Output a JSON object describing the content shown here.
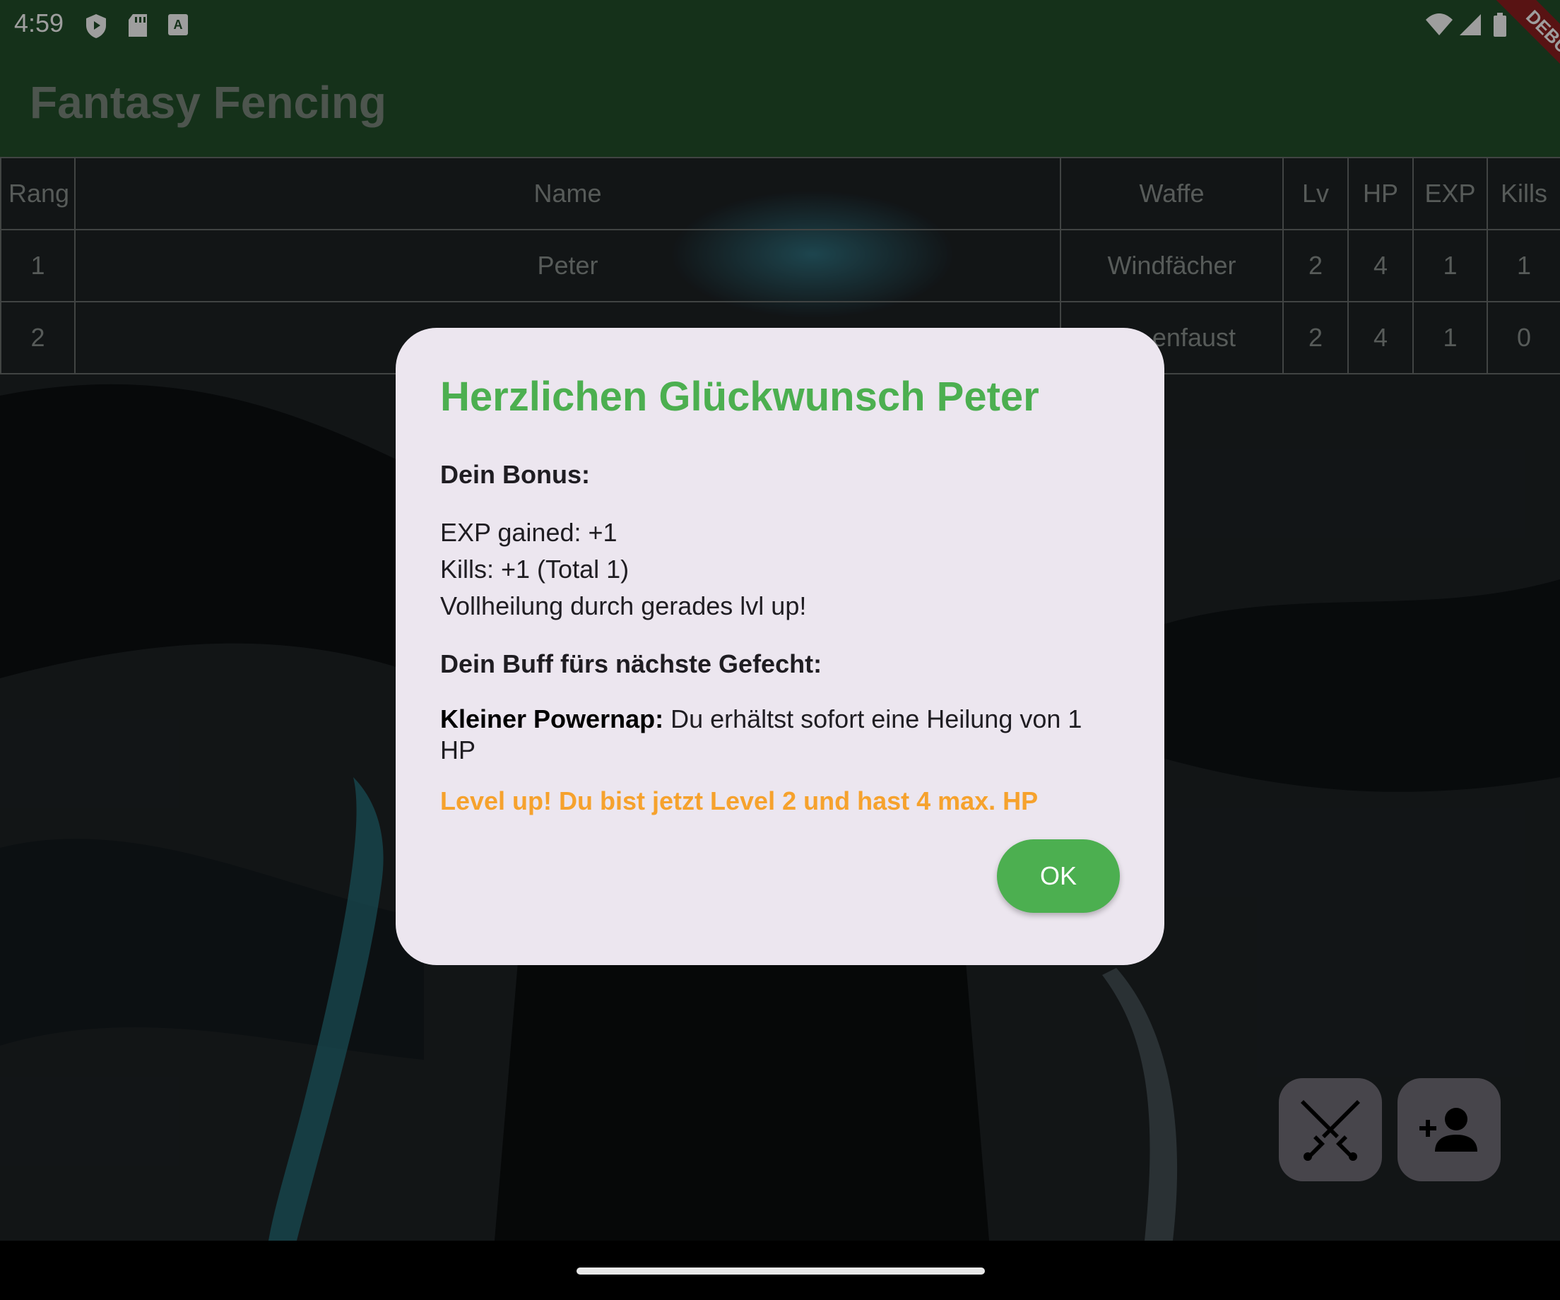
{
  "status_bar": {
    "time": "4:59",
    "icons": [
      "shield-icon",
      "sd-card-icon",
      "font-icon",
      "wifi-icon",
      "signal-icon",
      "battery-icon"
    ]
  },
  "app_bar": {
    "title": "Fantasy Fencing"
  },
  "debug_banner": {
    "label": "DEBUG"
  },
  "table": {
    "headers": [
      "Rang",
      "Name",
      "Waffe",
      "Lv",
      "HP",
      "EXP",
      "Kills"
    ],
    "rows": [
      {
        "rang": "1",
        "name": "Peter",
        "waffe": "Windfächer",
        "lv": "2",
        "hp": "4",
        "exp": "1",
        "kills": "1"
      },
      {
        "rang": "2",
        "name": "",
        "waffe": "enfaust",
        "lv": "2",
        "hp": "4",
        "exp": "1",
        "kills": "0"
      }
    ]
  },
  "dialog": {
    "title": "Herzlichen Glückwunsch Peter",
    "bonus_heading": "Dein Bonus:",
    "bonus_lines": [
      "EXP gained: +1",
      "Kills: +1 (Total 1)",
      "Vollheilung durch gerades lvl up!"
    ],
    "buff_heading": "Dein Buff fürs nächste Gefecht:",
    "buff_name": "Kleiner Powernap:",
    "buff_text": " Du erhältst sofort eine Heilung von 1 HP",
    "level_up": "Level up! Du bist jetzt Level 2 und hast 4 max. HP",
    "ok_label": "OK"
  },
  "fabs": [
    {
      "icon": "crossed-swords-icon"
    },
    {
      "icon": "add-person-icon"
    }
  ],
  "colors": {
    "app_bar": "#23502a",
    "title_green": "#4caf50",
    "level_up_orange": "#f6a22d",
    "dialog_bg": "#ece6ef",
    "fab_bg": "#73707a"
  }
}
